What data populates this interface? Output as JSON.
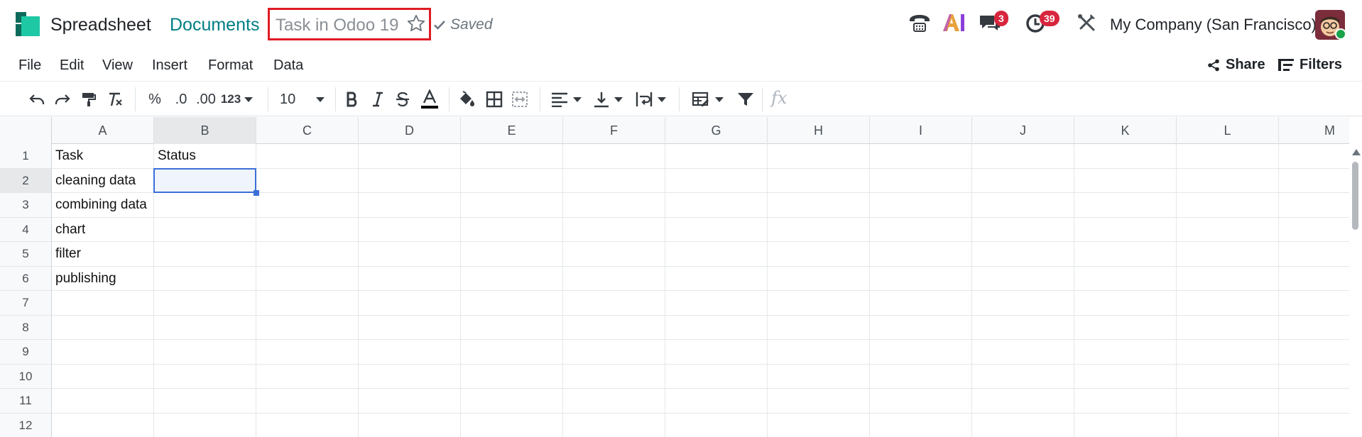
{
  "app": {
    "name": "Spreadsheet",
    "breadcrumb": "Documents",
    "document_title": "Task in Odoo 19",
    "saved_label": "Saved"
  },
  "header_right": {
    "messages_badge": "3",
    "activities_badge": "39",
    "company": "My Company (San Francisco)"
  },
  "menu": [
    "File",
    "Edit",
    "View",
    "Insert",
    "Format",
    "Data"
  ],
  "actions": {
    "share": "Share",
    "filters": "Filters"
  },
  "toolbar": {
    "percent": "%",
    "decrease_decimal": ".0",
    "increase_decimal": ".00",
    "more_formats": "123",
    "font_size": "10",
    "fx": "fx"
  },
  "grid": {
    "columns": [
      "A",
      "B",
      "C",
      "D",
      "E",
      "F",
      "G",
      "H",
      "I",
      "J",
      "K",
      "L",
      "M"
    ],
    "rows": [
      "1",
      "2",
      "3",
      "4",
      "5",
      "6",
      "7",
      "8",
      "9",
      "10",
      "11",
      "12"
    ],
    "active_cell": "B2",
    "cells": {
      "A1": "Task",
      "B1": "Status",
      "A2": "cleaning data",
      "A3": "combining data",
      "A4": "chart",
      "A5": "filter",
      "A6": "publishing"
    }
  },
  "colors": {
    "brand_teal": "#017e84",
    "highlight_red": "#e01b24",
    "selection_blue": "#3a6fd8",
    "badge_red": "#d7263d"
  }
}
